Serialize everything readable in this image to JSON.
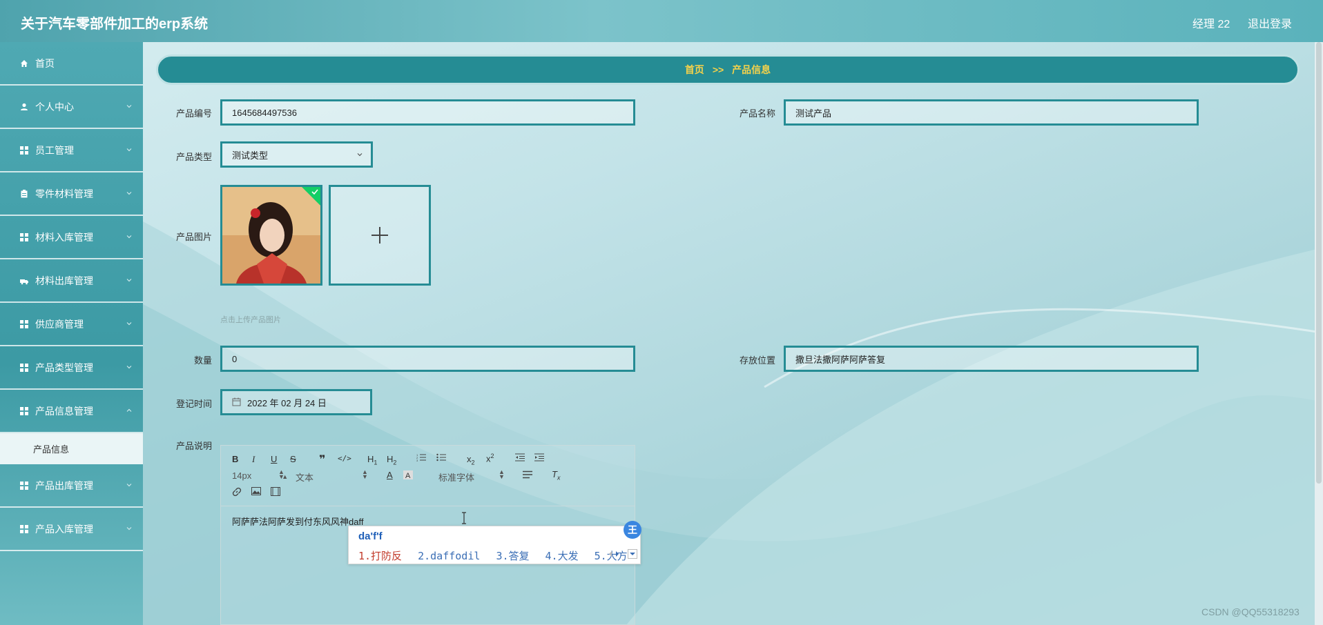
{
  "header": {
    "title": "关于汽车零部件加工的erp系统",
    "user": "经理 22",
    "logout": "退出登录"
  },
  "sidebar": {
    "items": [
      {
        "label": "首页",
        "icon": "home-icon"
      },
      {
        "label": "个人中心",
        "icon": "user-icon"
      },
      {
        "label": "员工管理",
        "icon": "grid-icon"
      },
      {
        "label": "零件材料管理",
        "icon": "clipboard-icon"
      },
      {
        "label": "材料入库管理",
        "icon": "grid-icon"
      },
      {
        "label": "材料出库管理",
        "icon": "truck-icon"
      },
      {
        "label": "供应商管理",
        "icon": "grid-icon"
      },
      {
        "label": "产品类型管理",
        "icon": "grid-icon"
      },
      {
        "label": "产品信息管理",
        "icon": "grid-icon"
      },
      {
        "label": "产品出库管理",
        "icon": "grid-icon"
      },
      {
        "label": "产品入库管理",
        "icon": "grid-icon"
      }
    ],
    "active_sub": "产品信息"
  },
  "breadcrumb": {
    "home": "首页",
    "sep": ">>",
    "current": "产品信息"
  },
  "form": {
    "product_no": {
      "label": "产品编号",
      "value": "1645684497536"
    },
    "product_name": {
      "label": "产品名称",
      "value": "测试产品"
    },
    "product_type": {
      "label": "产品类型",
      "value": "测试类型"
    },
    "product_image": {
      "label": "产品图片",
      "hint": "点击上传产品图片"
    },
    "quantity": {
      "label": "数量",
      "value": "0"
    },
    "location": {
      "label": "存放位置",
      "value": "撒旦法撒阿萨阿萨答复"
    },
    "reg_time": {
      "label": "登记时间",
      "value": "2022 年 02 月 24 日"
    },
    "description": {
      "label": "产品说明"
    }
  },
  "editor": {
    "size": "14px",
    "header_select": "文本",
    "font_select": "标准字体",
    "content_prefix": "阿萨萨法阿萨发到付东风风神",
    "content_typing": "daff"
  },
  "ime": {
    "composition": "da'f'f",
    "candidates": [
      "1.打防反",
      "2.daffodil",
      "3.答复",
      "4.大发",
      "5.大方"
    ],
    "badge": "王"
  },
  "watermark": "CSDN @QQ55318293",
  "colors": {
    "accent": "#258c94",
    "crumb_text": "#f6d24a",
    "check": "#13ce66"
  }
}
